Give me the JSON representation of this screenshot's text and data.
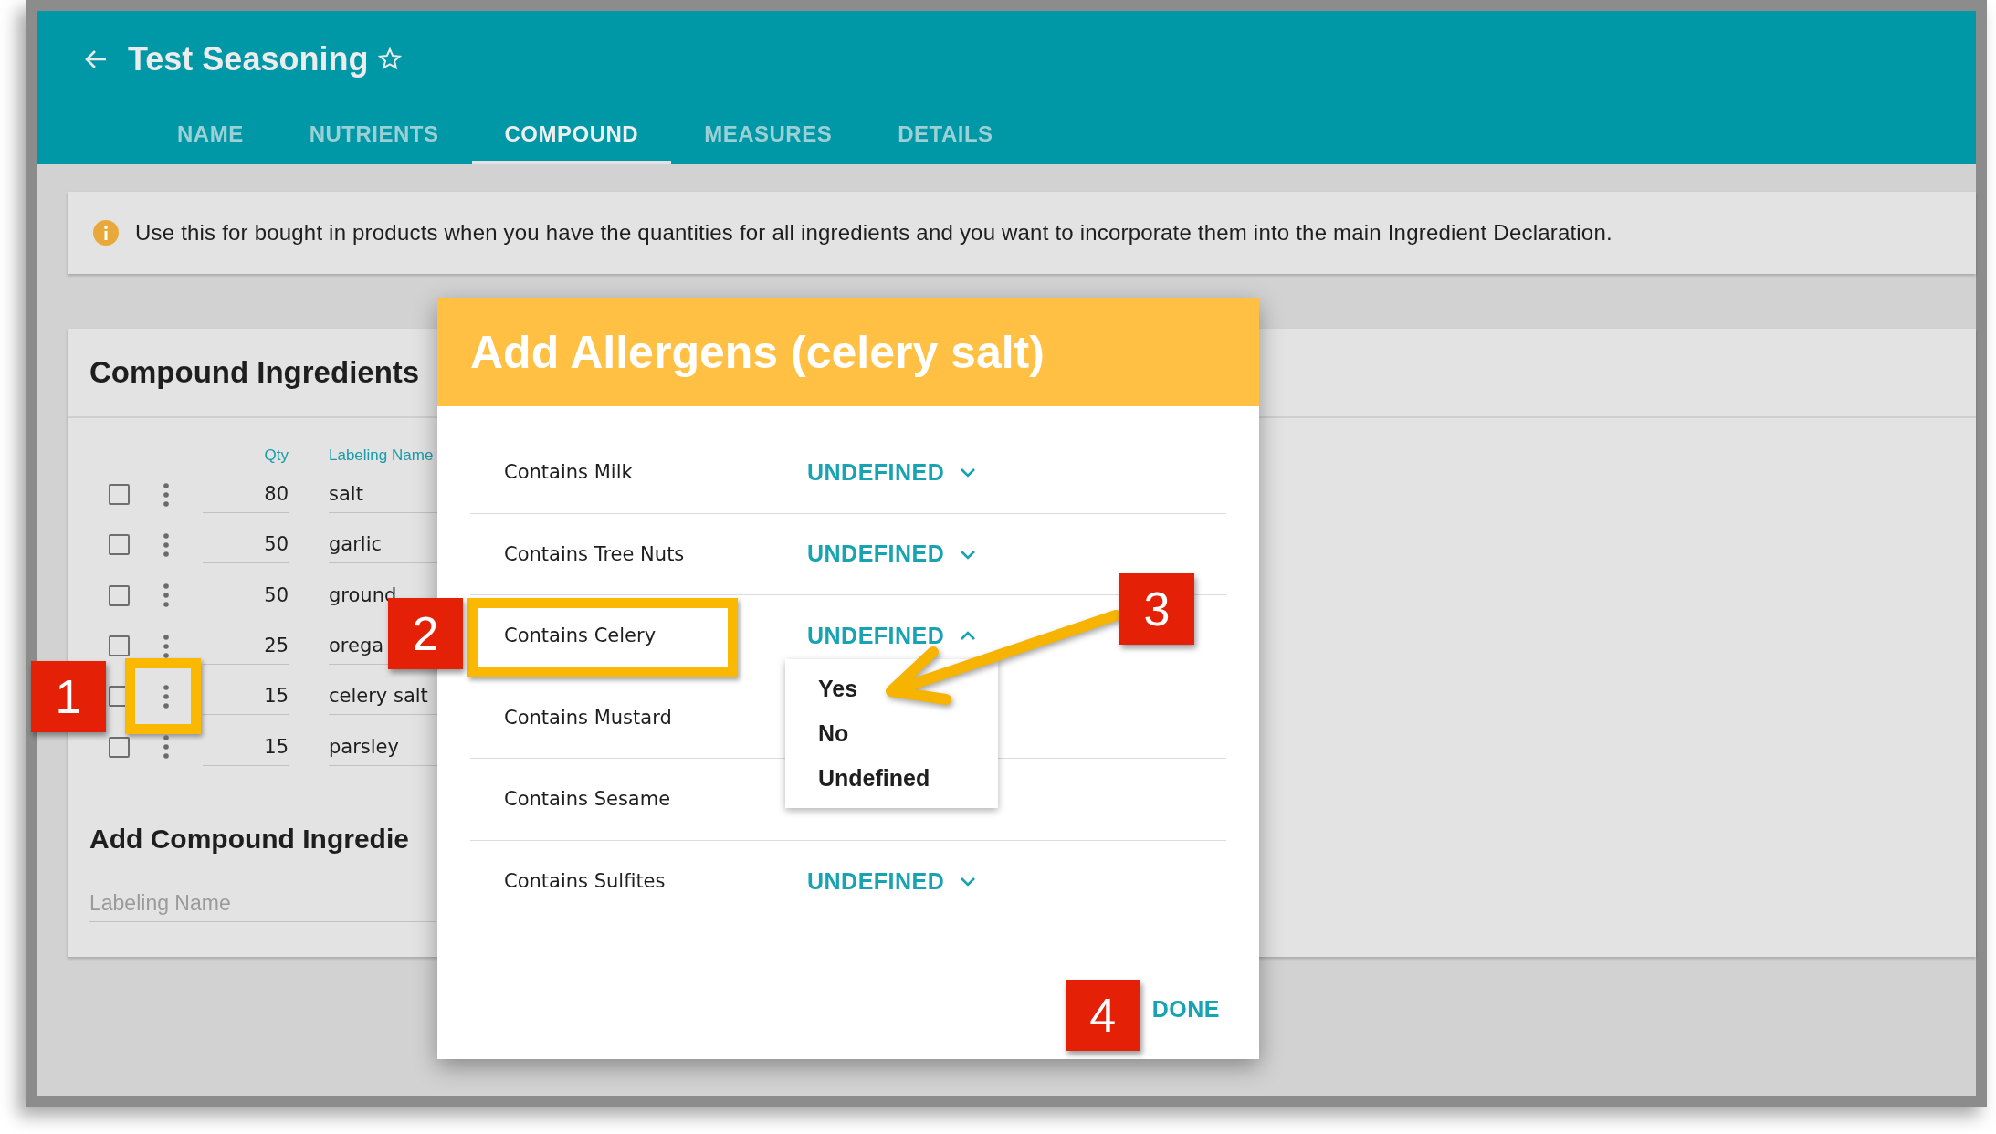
{
  "app_bar": {
    "title": "Test Seasoning",
    "tabs": [
      {
        "label": "NAME",
        "selected": false
      },
      {
        "label": "NUTRIENTS",
        "selected": false
      },
      {
        "label": "COMPOUND",
        "selected": true
      },
      {
        "label": "MEASURES",
        "selected": false
      },
      {
        "label": "DETAILS",
        "selected": false
      }
    ]
  },
  "info_banner": {
    "text": "Use this for bought in products when you have the quantities for all ingredients and you want to incorporate them into the main Ingredient Declaration."
  },
  "compound_card": {
    "title": "Compound Ingredients",
    "columns": [
      "Qty",
      "Labeling Name"
    ],
    "rows": [
      {
        "checked": false,
        "qty": "80",
        "name": "salt"
      },
      {
        "checked": false,
        "qty": "50",
        "name": "garlic"
      },
      {
        "checked": false,
        "qty": "50",
        "name": "ground"
      },
      {
        "checked": false,
        "qty": "25",
        "name": "orega"
      },
      {
        "checked": false,
        "qty": "15",
        "name": "celery salt",
        "callout": {
          "number": "1",
          "highlight": true
        }
      },
      {
        "checked": false,
        "qty": "15",
        "name": "parsley"
      }
    ],
    "add_title": "Add Compound Ingredie",
    "name_field": {
      "placeholder": "Labeling Name"
    }
  },
  "dialog": {
    "title": "Add Allergens (celery salt)",
    "allergens": [
      {
        "label": "Contains Milk",
        "value": "UNDEFINED",
        "expanded": false
      },
      {
        "label": "Contains Tree Nuts",
        "value": "UNDEFINED",
        "expanded": false
      },
      {
        "label": "Contains Celery",
        "value": "UNDEFINED",
        "expanded": true,
        "callout": {
          "number": "2",
          "highlight": true
        },
        "menu": {
          "options": [
            "Yes",
            "No",
            "Undefined"
          ],
          "callout": {
            "number": "3",
            "highlight": false
          }
        }
      },
      {
        "label": "Contains Mustard"
      },
      {
        "label": "Contains Sesame"
      },
      {
        "label": "Contains Sulfites",
        "value": "UNDEFINED",
        "expanded": false
      }
    ],
    "done": {
      "label": "DONE",
      "callout": {
        "number": "4",
        "highlight": false
      }
    }
  }
}
